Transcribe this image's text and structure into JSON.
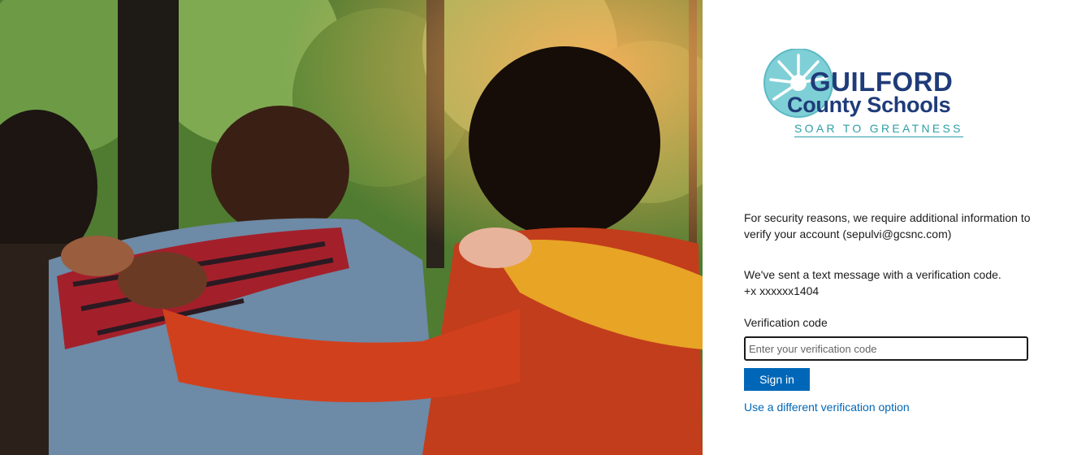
{
  "hero": {
    "icon": "group-of-students-photo"
  },
  "logo": {
    "icon": "sun-burst-logo-icon",
    "line1": "GUILFORD",
    "line2": "County Schools",
    "tagline": "SOAR TO GREATNESS"
  },
  "content": {
    "security_message": "For security reasons, we require additional information to verify your account (sepulvi@gcsnc.com)",
    "sent_message": "We've sent a text message with a verification code.",
    "phone_masked": "+x xxxxxx1404",
    "verification_label": "Verification code",
    "verification_placeholder": "Enter your verification code",
    "signin_label": "Sign in",
    "alt_option_link": "Use a different verification option"
  },
  "colors": {
    "accent": "#0067b8",
    "brand_navy": "#1f3b79",
    "brand_teal": "#2d9fa6"
  }
}
